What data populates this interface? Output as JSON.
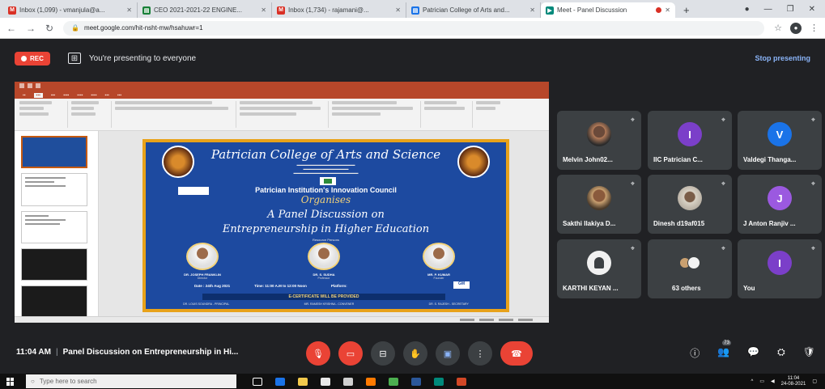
{
  "browser": {
    "tabs": [
      {
        "title": "Inbox (1,099) - vmanjula@a...",
        "fav_color": "#d93025",
        "fav_glyph": "M"
      },
      {
        "title": "CEO 2021-2021-22 ENGINE...",
        "fav_color": "#188038",
        "fav_glyph": "▤"
      },
      {
        "title": "Inbox (1,734) - rajamani@...",
        "fav_color": "#d93025",
        "fav_glyph": "M"
      },
      {
        "title": "Patrician College of Arts and...",
        "fav_color": "#1a73e8",
        "fav_glyph": "▤"
      },
      {
        "title": "Meet - Panel Discussion",
        "fav_color": "#00897b",
        "fav_glyph": "▶",
        "active": true
      }
    ],
    "new_tab": "+",
    "url": "meet.google.com/hit-nsht-mw/hsahuwr=1"
  },
  "meet": {
    "rec_label": "REC",
    "presenting_text": "You're presenting to everyone",
    "stop_label": "Stop presenting",
    "participants": [
      {
        "name": "Melvin John02...",
        "avatar": "photo1",
        "initial": ""
      },
      {
        "name": "IIC Patrician C...",
        "avatar": "letter",
        "initial": "I",
        "color": "#7b3fc9"
      },
      {
        "name": "Valdegi Thanga...",
        "avatar": "letter",
        "initial": "V",
        "color": "#1a73e8"
      },
      {
        "name": "Sakthi Ilakiya D...",
        "avatar": "photo2",
        "initial": ""
      },
      {
        "name": "Dinesh d19af015",
        "avatar": "photo3",
        "initial": ""
      },
      {
        "name": "J Anton Ranjiv ...",
        "avatar": "letter",
        "initial": "J",
        "color": "#9b59e0"
      },
      {
        "name": "KARTHI KEYAN ...",
        "avatar": "photo4",
        "initial": ""
      },
      {
        "name": "63 others",
        "avatar": "others",
        "initial": ""
      },
      {
        "name": "You",
        "avatar": "letter",
        "initial": "I",
        "color": "#7b3fc9"
      }
    ],
    "time": "11:04 AM",
    "separator": "|",
    "meeting_name": "Panel Discussion on Entrepreneurship in Hi...",
    "participant_count": "73"
  },
  "poster": {
    "college": "Patrician College of Arts and Science",
    "council": "Patrician Institution's Innovation Council",
    "organises": "Organises",
    "panel": "A Panel Discussion on",
    "topic": "Entrepreneurship in Higher Education",
    "resource": "Resource Persons",
    "speakers": [
      {
        "name": "DR. JOSEPH FRANKLIN",
        "desc": "Director"
      },
      {
        "name": "DR. S. SUDHA",
        "desc": "Professor"
      },
      {
        "name": "MR. P. KUMAR",
        "desc": "Founder"
      }
    ],
    "date": "Date : 24th Aug 2021",
    "time": "Time: 11:00 A.M to 12:00 Noon",
    "platform": "Platform:",
    "platform_tag": "GM",
    "certificate": "E-CERTIFICATE WILL BE PROVIDED",
    "footer": [
      "DR. LOUIS SOUNDRA - PRINCIPAL",
      "MR. RAMESH KRISHNA - CONVENER",
      "DR. S. RAJESH - SECRETARY"
    ]
  },
  "taskbar": {
    "search_placeholder": "Type here to search",
    "time": "11:04",
    "date": "24-08-2021"
  }
}
